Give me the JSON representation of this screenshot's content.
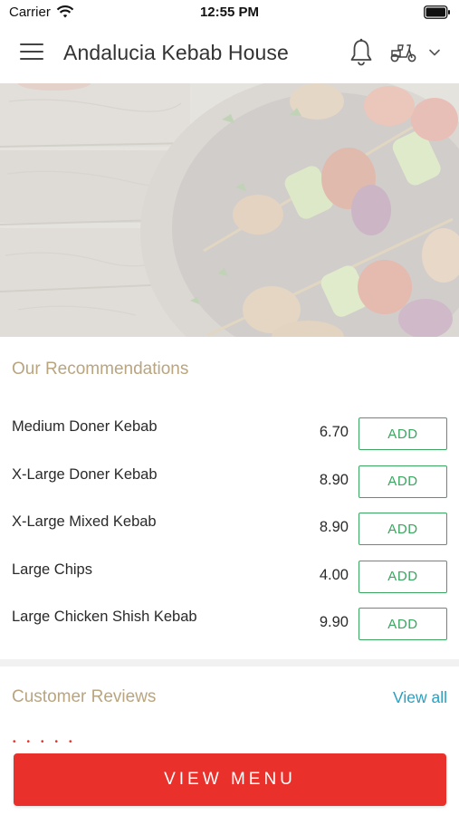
{
  "status_bar": {
    "carrier": "Carrier",
    "time": "12:55 PM"
  },
  "header": {
    "title": "Andalucia Kebab House",
    "icons": [
      "menu-icon",
      "bell-icon",
      "delivery-scooter-icon",
      "chevron-down-icon"
    ]
  },
  "hero": {
    "image": "kebab-skewers-photo"
  },
  "recommendations": {
    "title": "Our Recommendations",
    "add_label": "ADD",
    "items": [
      {
        "name": "Medium Doner Kebab",
        "price": "6.70"
      },
      {
        "name": "X-Large Doner Kebab",
        "price": "8.90"
      },
      {
        "name": "X-Large Mixed Kebab",
        "price": "8.90"
      },
      {
        "name": "Large Chips",
        "price": "4.00"
      },
      {
        "name": "Large Chicken Shish Kebab",
        "price": "9.90"
      }
    ]
  },
  "reviews": {
    "title": "Customer Reviews",
    "view_all": "View all"
  },
  "footer": {
    "view_menu": "VIEW MENU"
  },
  "colors": {
    "accent_red": "#e9302a",
    "add_green": "#3aa660",
    "section_gold": "#b9a57f",
    "link_blue": "#2a9fc0"
  }
}
